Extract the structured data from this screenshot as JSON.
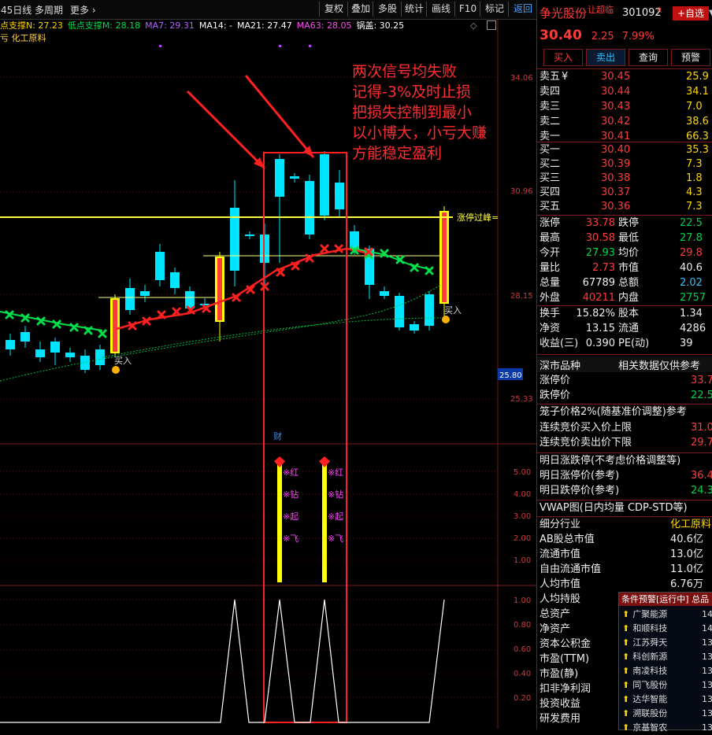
{
  "toolbar": {
    "period": "45日线",
    "multi_period": "多周期",
    "more": "更多",
    "buttons": [
      "复权",
      "叠加",
      "多股",
      "统计",
      "画线",
      "F10",
      "标记",
      "返回"
    ]
  },
  "legend": {
    "items": [
      {
        "text": "点支撑N: 27.23",
        "color": "#ffd400"
      },
      {
        "text": "低点支撑M: 28.18",
        "color": "#00e04a"
      },
      {
        "text": "MA7: 29.31",
        "color": "#b060ff"
      },
      {
        "text": "MA14: -",
        "color": "#ffffff"
      },
      {
        "text": "MA21: 27.47",
        "color": "#ffffff"
      },
      {
        "text": "MA63: 28.05",
        "color": "#ff4df0"
      },
      {
        "text": "锅盖: 30.25",
        "color": "#ffffff"
      }
    ],
    "industry_line": "亏 化工原料"
  },
  "annotation": {
    "lines": [
      "两次信号均失败",
      "记得-3%及时止损",
      "把损失控制到最小",
      "以小博大，小亏大赚",
      "方能稳定盈利"
    ]
  },
  "chart": {
    "price_axis": [
      "34.06",
      "30.96",
      "28.15",
      "25.80",
      "25.33"
    ],
    "indicator_axis": [
      "5.00",
      "4.00",
      "3.00",
      "2.00",
      "1.00"
    ],
    "osc_axis": [
      "1.00",
      "0.80",
      "0.60",
      "0.40",
      "0.20"
    ],
    "limit_up_label": "涨停过峰=",
    "buy_label": "买入",
    "caifu_label": "财",
    "signal_tags": [
      "红",
      "钻",
      "起",
      "飞"
    ],
    "colors": {
      "up": "#ff3b3b",
      "down": "#00e5ff",
      "ma_red": "#ff2020",
      "ma_green": "#00e04a",
      "signal": "#ffff00"
    }
  },
  "quote": {
    "name": "争光股份",
    "tag": "让超临",
    "code": "301092",
    "r_mark": "R",
    "add_watch": "+自选",
    "price": "30.40",
    "change": "2.25",
    "pct": "7.99%",
    "buttons": [
      "买入",
      "卖出",
      "查询",
      "预警"
    ],
    "asks": [
      {
        "label": "卖五",
        "flag": "¥",
        "price": "30.45",
        "vol": "25.9"
      },
      {
        "label": "卖四",
        "flag": "",
        "price": "30.44",
        "vol": "34.1"
      },
      {
        "label": "卖三",
        "flag": "",
        "price": "30.43",
        "vol": "7.0"
      },
      {
        "label": "卖二",
        "flag": "",
        "price": "30.42",
        "vol": "38.6"
      },
      {
        "label": "卖一",
        "flag": "",
        "price": "30.41",
        "vol": "66.3"
      }
    ],
    "bids": [
      {
        "label": "买一",
        "price": "30.40",
        "vol": "35.3"
      },
      {
        "label": "买二",
        "price": "30.39",
        "vol": "7.3"
      },
      {
        "label": "买三",
        "price": "30.38",
        "vol": "1.8"
      },
      {
        "label": "买四",
        "price": "30.37",
        "vol": "4.3"
      },
      {
        "label": "买五",
        "price": "30.36",
        "vol": "7.3"
      }
    ],
    "stats": [
      {
        "l1": "涨停",
        "v1": "33.78",
        "c1": "red",
        "l2": "跌停",
        "v2": "22.5",
        "c2": "grn"
      },
      {
        "l1": "最高",
        "v1": "30.58",
        "c1": "red",
        "l2": "最低",
        "v2": "27.8",
        "c2": "grn"
      },
      {
        "l1": "今开",
        "v1": "27.93",
        "c1": "grn",
        "l2": "均价",
        "v2": "29.8",
        "c2": "red"
      },
      {
        "l1": "量比",
        "v1": "2.73",
        "c1": "red",
        "l2": "市值",
        "v2": "40.6",
        "c2": "wht"
      },
      {
        "l1": "总量",
        "v1": "67789",
        "c1": "wht",
        "l2": "总额",
        "v2": "2.02",
        "c2": "cyan"
      },
      {
        "l1": "外盘",
        "v1": "40211",
        "c1": "red",
        "l2": "内盘",
        "v2": "2757",
        "c2": "grn"
      }
    ],
    "stats2": [
      {
        "l1": "换手",
        "v1": "15.82%",
        "l2": "股本",
        "v2": "1.34"
      },
      {
        "l1": "净资",
        "v1": "13.15",
        "l2": "流通",
        "v2": "4286"
      },
      {
        "l1": "收益(三)",
        "v1": "0.390",
        "l2": "PE(动)",
        "v2": "39"
      }
    ],
    "market_section": {
      "title": "深市品种",
      "note": "相关数据仅供参考"
    },
    "limit_rows": [
      {
        "label": "涨停价",
        "value": "33.7",
        "color": "red"
      },
      {
        "label": "跌停价",
        "value": "22.5",
        "color": "grn"
      }
    ],
    "cage": {
      "title": "笼子价格2%(随基准价调整)参考",
      "rows": [
        {
          "label": "连续竞价买入价上限",
          "value": "31.0",
          "color": "red"
        },
        {
          "label": "连续竞价卖出价下限",
          "value": "29.7",
          "color": "red"
        }
      ]
    },
    "tomorrow": {
      "title": "明日涨跌停(不考虑价格调整等)",
      "rows": [
        {
          "label": "明日涨停价(参考)",
          "value": "36.4",
          "color": "red"
        },
        {
          "label": "明日跌停价(参考)",
          "value": "24.3",
          "color": "grn"
        }
      ]
    },
    "vwap": "VWAP图(日内均量 CDP-STD等)",
    "fundamentals": [
      {
        "label": "细分行业",
        "value": "化工原料",
        "color": "yel"
      },
      {
        "label": "AB股总市值",
        "value": "40.6亿",
        "color": "wht"
      },
      {
        "label": "流通市值",
        "value": "13.0亿",
        "color": "wht"
      },
      {
        "label": "自由流通市值",
        "value": "11.0亿",
        "color": "wht"
      },
      {
        "label": "人均市值",
        "value": "6.76万",
        "color": "wht"
      },
      {
        "label": "人均持股",
        "value": "",
        "color": "wht"
      },
      {
        "label": "总资产",
        "value": "",
        "color": "wht"
      },
      {
        "label": "净资产",
        "value": "",
        "color": "wht"
      },
      {
        "label": "资本公积金",
        "value": "",
        "color": "wht"
      },
      {
        "label": "市盈(TTM)",
        "value": "",
        "color": "wht"
      },
      {
        "label": "市盈(静)",
        "value": "",
        "color": "wht"
      },
      {
        "label": "扣非净利润",
        "value": "",
        "color": "wht"
      },
      {
        "label": "投资收益",
        "value": "",
        "color": "wht"
      },
      {
        "label": "研发费用",
        "value": "",
        "color": "wht"
      }
    ]
  },
  "alerts": {
    "title": "条件预警[运行中] 总品",
    "items": [
      {
        "name": "广聚能源",
        "n": "14"
      },
      {
        "name": "和顺科技",
        "n": "14"
      },
      {
        "name": "江苏舜天",
        "n": "13"
      },
      {
        "name": "科创新源",
        "n": "13"
      },
      {
        "name": "南凌科技",
        "n": "13"
      },
      {
        "name": "同飞股份",
        "n": "13"
      },
      {
        "name": "达华智能",
        "n": "13"
      },
      {
        "name": "溯联股份",
        "n": "13"
      },
      {
        "name": "京基智农",
        "n": "13"
      }
    ]
  }
}
